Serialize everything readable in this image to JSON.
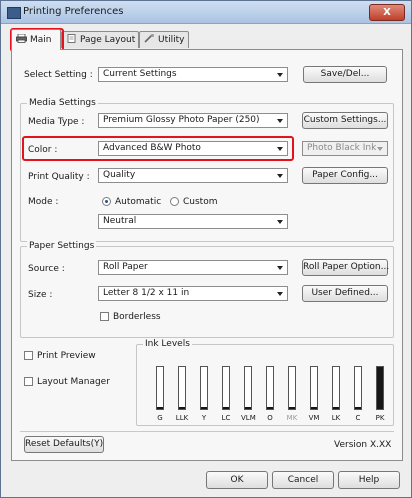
{
  "window": {
    "title": "Printing Preferences",
    "close_glyph": "X"
  },
  "tabs": [
    {
      "label": "Main",
      "icon": "printer-icon",
      "active": true
    },
    {
      "label": "Page Layout",
      "icon": "page-layout-icon",
      "active": false
    },
    {
      "label": "Utility",
      "icon": "utility-icon",
      "active": false
    }
  ],
  "select_setting": {
    "label": "Select Setting :",
    "value": "Current Settings",
    "save_button": "Save/Del..."
  },
  "media_settings": {
    "title": "Media Settings",
    "media_type_label": "Media Type :",
    "media_type_value": "Premium Glossy Photo Paper (250)",
    "custom_settings_button": "Custom Settings...",
    "color_label": "Color :",
    "color_value": "Advanced B&W Photo",
    "black_ink_value": "Photo Black Ink",
    "print_quality_label": "Print Quality :",
    "print_quality_value": "Quality",
    "paper_config_button": "Paper Config...",
    "mode_label": "Mode :",
    "mode_automatic": "Automatic",
    "mode_custom": "Custom",
    "mode_selected": "Automatic",
    "tone_value": "Neutral"
  },
  "paper_settings": {
    "title": "Paper Settings",
    "source_label": "Source :",
    "source_value": "Roll Paper",
    "roll_paper_option_button": "Roll Paper Option...",
    "size_label": "Size :",
    "size_value": "Letter 8 1/2 x 11 in",
    "user_defined_button": "User Defined...",
    "borderless_label": "Borderless",
    "borderless_checked": false
  },
  "print_preview": {
    "label": "Print Preview",
    "checked": false
  },
  "layout_manager": {
    "label": "Layout Manager",
    "checked": false
  },
  "ink_levels": {
    "title": "Ink Levels",
    "inks": [
      {
        "name": "G",
        "level": 0.05,
        "faded": false
      },
      {
        "name": "LLK",
        "level": 0.05,
        "faded": false
      },
      {
        "name": "Y",
        "level": 0.05,
        "faded": false
      },
      {
        "name": "LC",
        "level": 0.05,
        "faded": false
      },
      {
        "name": "VLM",
        "level": 0.05,
        "faded": false
      },
      {
        "name": "O",
        "level": 0.05,
        "faded": false
      },
      {
        "name": "MK",
        "level": 0.05,
        "faded": true
      },
      {
        "name": "VM",
        "level": 0.05,
        "faded": false
      },
      {
        "name": "LK",
        "level": 0.05,
        "faded": false
      },
      {
        "name": "C",
        "level": 0.05,
        "faded": false
      },
      {
        "name": "PK",
        "level": 1.0,
        "faded": false
      }
    ]
  },
  "footer": {
    "reset_defaults_button": "Reset Defaults(Y)",
    "version_text": "Version X.XX",
    "ok_button": "OK",
    "cancel_button": "Cancel",
    "help_button": "Help"
  },
  "colors": {
    "highlight": "#e3131b",
    "title_bar": "#aac3e3",
    "ink_fill": "#161616"
  }
}
